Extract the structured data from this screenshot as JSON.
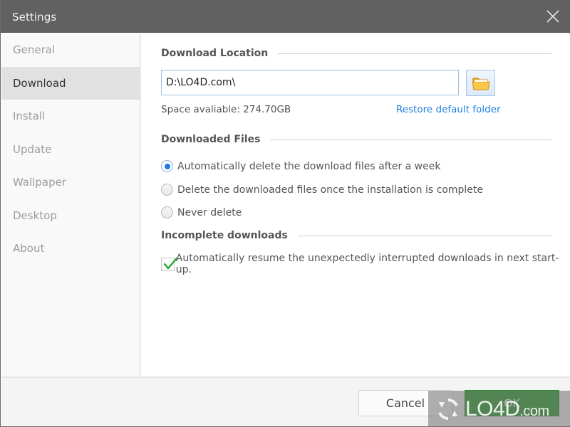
{
  "window": {
    "title": "Settings"
  },
  "sidebar": {
    "items": [
      {
        "label": "General",
        "active": false
      },
      {
        "label": "Download",
        "active": true
      },
      {
        "label": "Install",
        "active": false
      },
      {
        "label": "Update",
        "active": false
      },
      {
        "label": "Wallpaper",
        "active": false
      },
      {
        "label": "Desktop",
        "active": false
      },
      {
        "label": "About",
        "active": false
      }
    ]
  },
  "download_location": {
    "heading": "Download Location",
    "path_value": "D:\\LO4D.com\\",
    "browse_icon": "folder-open-icon",
    "space_text": "Space avaliable: 274.70GB",
    "restore_link": "Restore default folder"
  },
  "downloaded_files": {
    "heading": "Downloaded Files",
    "options": [
      {
        "label": "Automatically delete the download files after a week",
        "checked": true
      },
      {
        "label": "Delete the downloaded files once the installation is complete",
        "checked": false
      },
      {
        "label": "Never delete",
        "checked": false
      }
    ]
  },
  "incomplete_downloads": {
    "heading": "Incomplete downloads",
    "resume_label": "Automatically resume the unexpectedly interrupted downloads in next start-up.",
    "resume_checked": true
  },
  "footer": {
    "cancel_label": "Cancel",
    "ok_label": "OK"
  },
  "colors": {
    "titlebar": "#616161",
    "accent_blue": "#1e7ae8",
    "link_blue": "#1e7fe0",
    "ok_green": "#34a033",
    "check_green": "#22a52a"
  },
  "watermark": {
    "text": "LO4D",
    "suffix": ".com"
  }
}
